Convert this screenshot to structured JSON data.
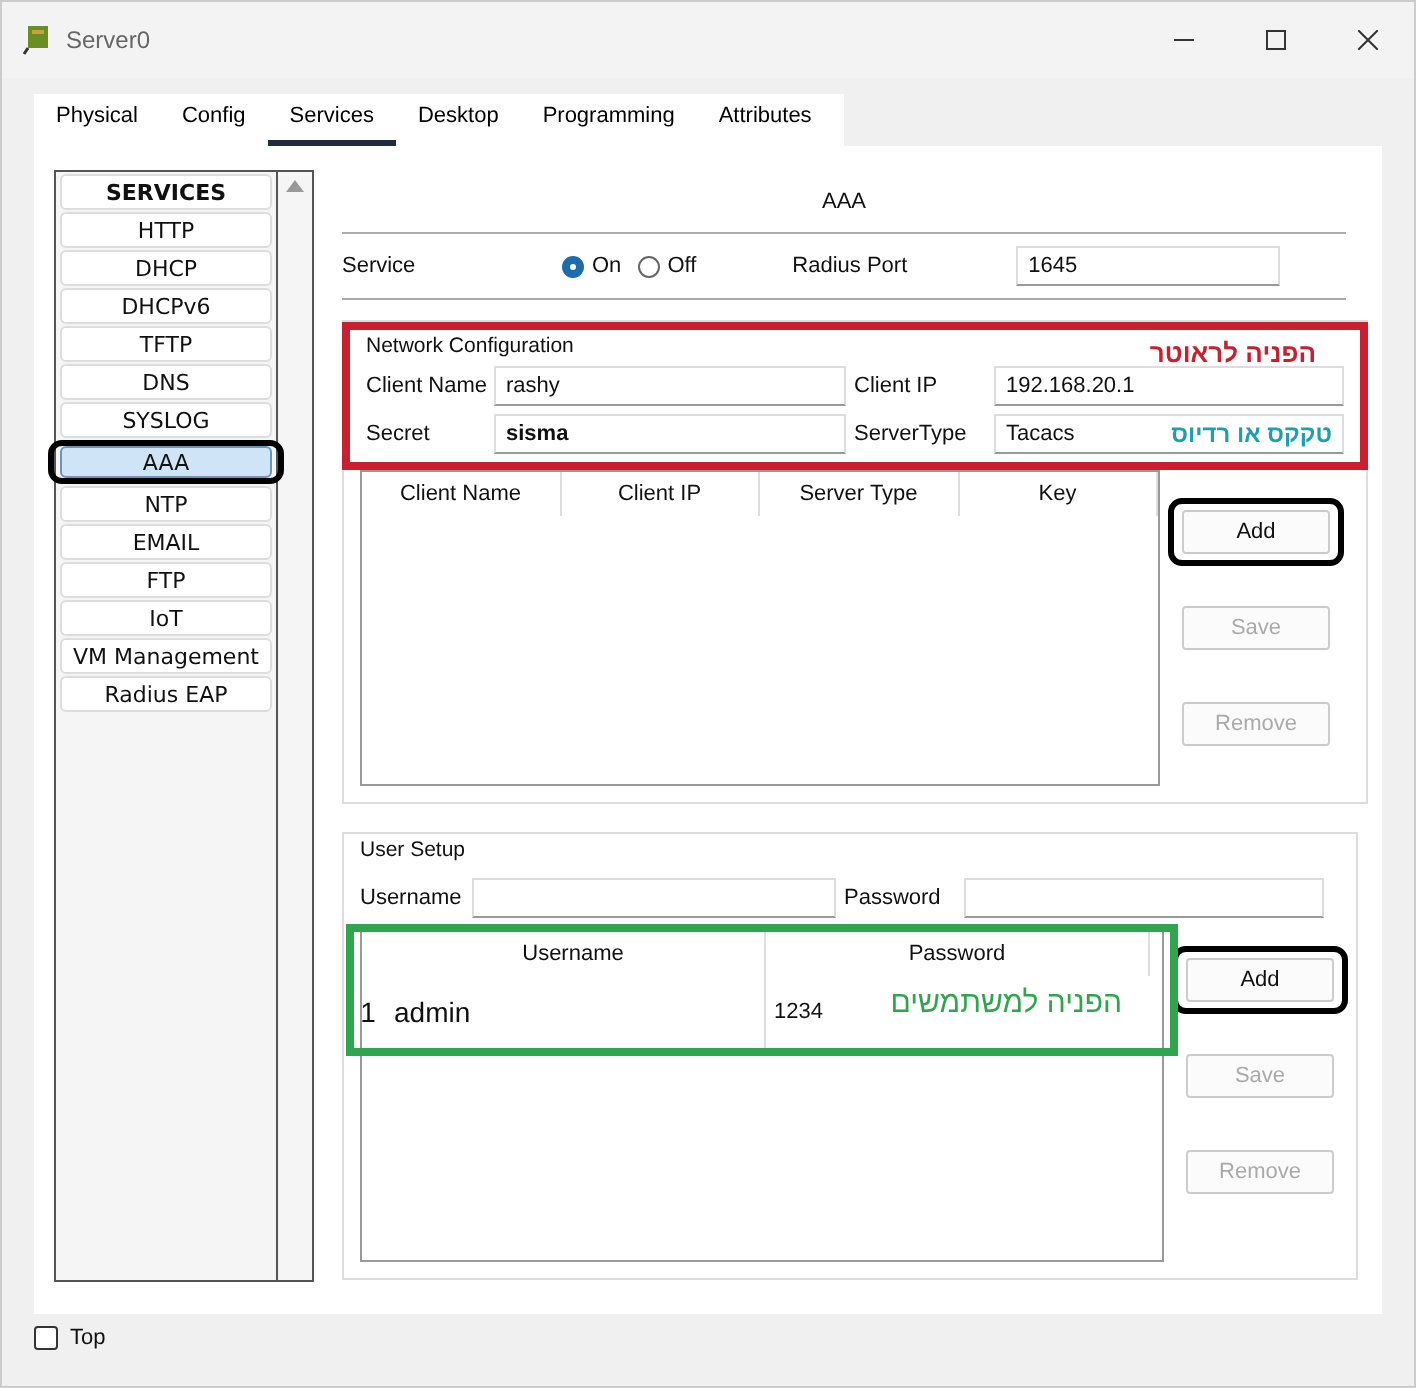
{
  "window": {
    "title": "Server0"
  },
  "tabs": [
    {
      "label": "Physical",
      "selected": false
    },
    {
      "label": "Config",
      "selected": false
    },
    {
      "label": "Services",
      "selected": true
    },
    {
      "label": "Desktop",
      "selected": false
    },
    {
      "label": "Programming",
      "selected": false
    },
    {
      "label": "Attributes",
      "selected": false
    }
  ],
  "sidebar": {
    "items": [
      {
        "label": "SERVICES",
        "kind": "header",
        "selected": false,
        "circled": false
      },
      {
        "label": "HTTP",
        "kind": "item",
        "selected": false,
        "circled": false
      },
      {
        "label": "DHCP",
        "kind": "item",
        "selected": false,
        "circled": false
      },
      {
        "label": "DHCPv6",
        "kind": "item",
        "selected": false,
        "circled": false
      },
      {
        "label": "TFTP",
        "kind": "item",
        "selected": false,
        "circled": false
      },
      {
        "label": "DNS",
        "kind": "item",
        "selected": false,
        "circled": false
      },
      {
        "label": "SYSLOG",
        "kind": "item",
        "selected": false,
        "circled": false
      },
      {
        "label": "AAA",
        "kind": "item",
        "selected": true,
        "circled": true
      },
      {
        "label": "NTP",
        "kind": "item",
        "selected": false,
        "circled": false
      },
      {
        "label": "EMAIL",
        "kind": "item",
        "selected": false,
        "circled": false
      },
      {
        "label": "FTP",
        "kind": "item",
        "selected": false,
        "circled": false
      },
      {
        "label": "IoT",
        "kind": "item",
        "selected": false,
        "circled": false
      },
      {
        "label": "VM Management",
        "kind": "item",
        "selected": false,
        "circled": false
      },
      {
        "label": "Radius EAP",
        "kind": "item",
        "selected": false,
        "circled": false
      }
    ]
  },
  "panel": {
    "title": "AAA",
    "service": {
      "label": "Service",
      "options": [
        {
          "label": "On",
          "selected": true
        },
        {
          "label": "Off",
          "selected": false
        }
      ]
    },
    "radius_port": {
      "label": "Radius Port",
      "value": "1645"
    },
    "network_configuration": {
      "title": "Network Configuration",
      "annotation": {
        "text": "הפניה לראוטר",
        "color": "#c8202f"
      },
      "client_name": {
        "label": "Client Name",
        "value": "rashy"
      },
      "client_ip": {
        "label": "Client IP",
        "value": "192.168.20.1"
      },
      "secret": {
        "label": "Secret",
        "value": "sisma"
      },
      "server_type": {
        "label": "ServerType",
        "value": "Tacacs",
        "note": "טקקס או רדיוס"
      },
      "table": {
        "columns": [
          "Client Name",
          "Client IP",
          "Server Type",
          "Key"
        ]
      },
      "buttons": [
        {
          "label": "Add",
          "disabled": false,
          "circled": true
        },
        {
          "label": "Save",
          "disabled": true,
          "circled": false
        },
        {
          "label": "Remove",
          "disabled": true,
          "circled": false
        }
      ]
    },
    "user_setup": {
      "title": "User Setup",
      "username": {
        "label": "Username"
      },
      "password": {
        "label": "Password"
      },
      "annotation": {
        "text": "הפניה למשתמשים",
        "color": "#2fa64e"
      },
      "table": {
        "columns": [
          "Username",
          "Password"
        ],
        "rows": [
          {
            "index": "1",
            "username": "admin",
            "password": "1234"
          }
        ]
      },
      "buttons": [
        {
          "label": "Add",
          "disabled": false,
          "circled": true
        },
        {
          "label": "Save",
          "disabled": true,
          "circled": false
        },
        {
          "label": "Remove",
          "disabled": true,
          "circled": false
        }
      ]
    }
  },
  "top_checkbox": {
    "label": "Top",
    "checked": false
  }
}
